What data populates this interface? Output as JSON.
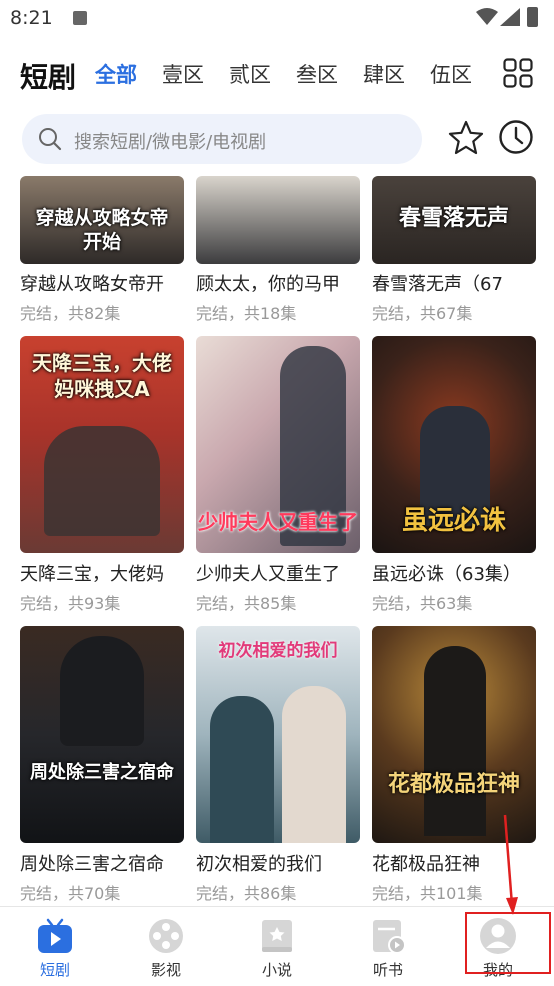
{
  "status_bar": {
    "time": "8:21"
  },
  "header": {
    "brand": "短剧",
    "tabs": [
      {
        "label": "全部"
      },
      {
        "label": "壹区"
      },
      {
        "label": "贰区"
      },
      {
        "label": "叁区"
      },
      {
        "label": "肆区"
      },
      {
        "label": "伍区"
      }
    ]
  },
  "search": {
    "placeholder": "搜索短剧/微电影/电视剧"
  },
  "dramas": [
    {
      "title": "穿越从攻略女帝开",
      "meta": "完结，共82集",
      "poster_text": "穿越从攻略女帝开始",
      "poster_color": "#3a3a3a"
    },
    {
      "title": "顾太太，你的马甲",
      "meta": "完结，共18集",
      "poster_text": "",
      "poster_color": "#5a5a5a"
    },
    {
      "title": "春雪落无声（67",
      "meta": "完结，共67集",
      "poster_text": "春雪落无声",
      "poster_color": "#3b3531"
    },
    {
      "title": "天降三宝，大佬妈",
      "meta": "完结，共93集",
      "poster_text": "天降三宝，大佬妈咪拽又A",
      "poster_color": "#b23a2c"
    },
    {
      "title": "少帅夫人又重生了",
      "meta": "完结，共85集",
      "poster_text": "少帅夫人又重生了",
      "poster_color": "#c8a9b0"
    },
    {
      "title": "虽远必诛（63集）",
      "meta": "完结，共63集",
      "poster_text": "虽远必诛",
      "poster_color": "#2d2420"
    },
    {
      "title": "周处除三害之宿命",
      "meta": "完结，共70集",
      "poster_text": "周处除三害之宿命",
      "poster_color": "#2a2c30"
    },
    {
      "title": "初次相爱的我们",
      "meta": "完结，共86集",
      "poster_text": "初次相爱的我们",
      "poster_color": "#6d8a9a"
    },
    {
      "title": "花都极品狂神",
      "meta": "完结，共101集",
      "poster_text": "花都极品狂神",
      "poster_color": "#4a3522"
    }
  ],
  "bottom_nav": [
    {
      "label": "短剧",
      "icon": "tv-play-icon",
      "active": true
    },
    {
      "label": "影视",
      "icon": "film-reel-icon",
      "active": false
    },
    {
      "label": "小说",
      "icon": "book-icon",
      "active": false
    },
    {
      "label": "听书",
      "icon": "audio-book-icon",
      "active": false
    },
    {
      "label": "我的",
      "icon": "user-avatar-icon",
      "active": false
    }
  ],
  "colors": {
    "accent": "#2b6fe0",
    "highlight": "#e02020"
  }
}
